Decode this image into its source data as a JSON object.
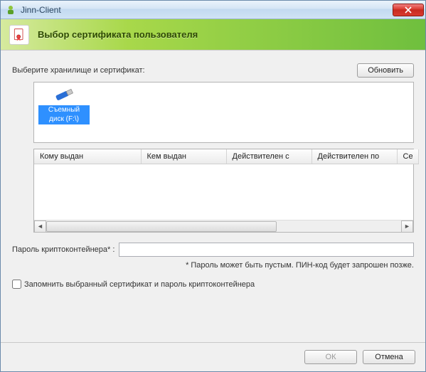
{
  "window": {
    "title": "Jinn-Client"
  },
  "header": {
    "heading": "Выбор сертификата пользователя"
  },
  "labels": {
    "select_storage": "Выберите хранилище и сертификат:",
    "refresh": "Обновить",
    "password": "Пароль криптоконтейнера* :",
    "hint": "* Пароль может быть пустым. ПИН-код будет запрошен позже.",
    "remember": "Запомнить выбранный сертификат и пароль криптоконтейнера",
    "ok": "ОК",
    "cancel": "Отмена"
  },
  "storage": {
    "items": [
      {
        "label": "Съемный диск (F:\\)"
      }
    ]
  },
  "cert_columns": {
    "issued_to": "Кому выдан",
    "issued_by": "Кем выдан",
    "valid_from": "Действителен с",
    "valid_to": "Действителен по",
    "serial": "Се"
  },
  "password_value": ""
}
